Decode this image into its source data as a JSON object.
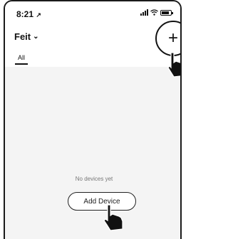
{
  "status_bar": {
    "time": "8:21",
    "location_arrow": "↗"
  },
  "header": {
    "title": "Feit",
    "title_chevron": "⌄",
    "add_button_symbol": "+",
    "tabs": [
      {
        "label": "All",
        "selected": true
      }
    ]
  },
  "main": {
    "empty_message": "No devices yet",
    "add_device_label": "Add Device"
  }
}
